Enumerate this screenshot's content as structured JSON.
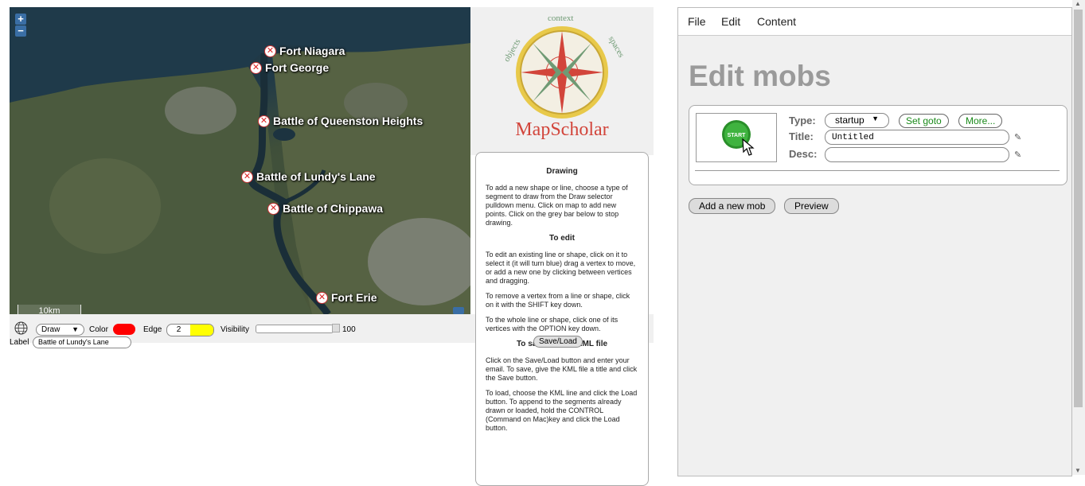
{
  "map": {
    "zoom_in": "+",
    "zoom_out": "−",
    "scale": "10km",
    "markers": [
      {
        "label": "Fort Niagara"
      },
      {
        "label": "Fort George"
      },
      {
        "label": "Battle of Queenston Heights"
      },
      {
        "label": "Battle of Lundy's Lane"
      },
      {
        "label": "Battle of Chippawa"
      },
      {
        "label": "Fort Erie"
      }
    ]
  },
  "toolbar": {
    "draw_select": "Draw",
    "color_label": "Color",
    "color_value": "#ff0000",
    "edge_label": "Edge",
    "edge_value": "2",
    "edge_color": "#ffff00",
    "visibility_label": "Visibility",
    "visibility_value": "100",
    "label_label": "Label",
    "label_value": "Battle of Lundy's Lane"
  },
  "logo": {
    "top_word": "context",
    "left_word": "objects",
    "right_word": "spaces",
    "name": "MapScholar"
  },
  "help": {
    "drawing_title": "Drawing",
    "drawing_text": "To add a new shape or line, choose a type of segment to draw from the Draw selector pulldown menu. Click on map to add new points. Click on the grey bar below to stop drawing.",
    "edit_title": "To edit",
    "edit_text": "To edit an existing line or shape, click on it to select it (it will turn blue) drag a vertex to move, or add a new one by clicking between vertices and dragging.",
    "remove_text": "To remove a vertex from a line or shape, click on it with the SHIFT key down.",
    "whole_text": "To the whole line or shape, click one of its vertices with the OPTION key down.",
    "save_load_button": "Save/Load",
    "kml_title": "To save or load KML file",
    "kml_text": "Click on the Save/Load button and enter your email. To save, give the KML file a title and click the Save button.",
    "load_text": "To load, choose the KML line and click the Load button. To append to the segments already drawn or loaded, hold the CONTROL (Command on Mac)key and click the Load button."
  },
  "editor": {
    "menu": {
      "file": "File",
      "edit": "Edit",
      "content": "Content"
    },
    "title": "Edit mobs",
    "mob": {
      "thumb_text": "START",
      "type_label": "Type:",
      "type_value": "startup",
      "set_goto": "Set goto",
      "more": "More...",
      "title_label": "Title:",
      "title_value": "Untitled",
      "desc_label": "Desc:",
      "desc_value": ""
    },
    "add_button": "Add a new mob",
    "preview_button": "Preview"
  }
}
